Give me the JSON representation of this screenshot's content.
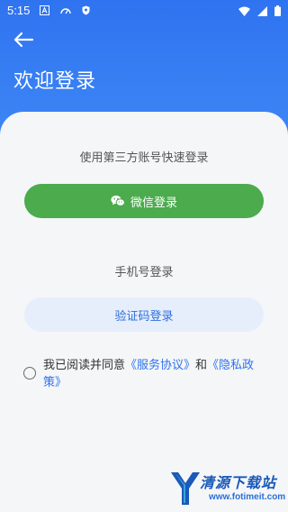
{
  "status_bar": {
    "time": "5:15"
  },
  "header": {
    "title": "欢迎登录"
  },
  "login": {
    "third_party_label": "使用第三方账号快速登录",
    "wechat_label": "微信登录",
    "phone_label": "手机号登录",
    "code_label": "验证码登录"
  },
  "agreement": {
    "text_before": "我已阅读并同意",
    "service_link": "《服务协议》",
    "conj": "和",
    "privacy_link": "《隐私政策》"
  },
  "watermark": {
    "name": "清源下载站",
    "url": "www.fotimeit.com"
  },
  "colors": {
    "brand_blue": "#2f73f0",
    "wechat_green": "#4bab4d",
    "card_bg": "#f4f6f8"
  },
  "icons": [
    "a-box-icon",
    "speed-icon",
    "shield-icon",
    "wifi-icon",
    "signal-icon",
    "battery-icon",
    "back-arrow-icon",
    "wechat-icon",
    "radio-icon"
  ]
}
